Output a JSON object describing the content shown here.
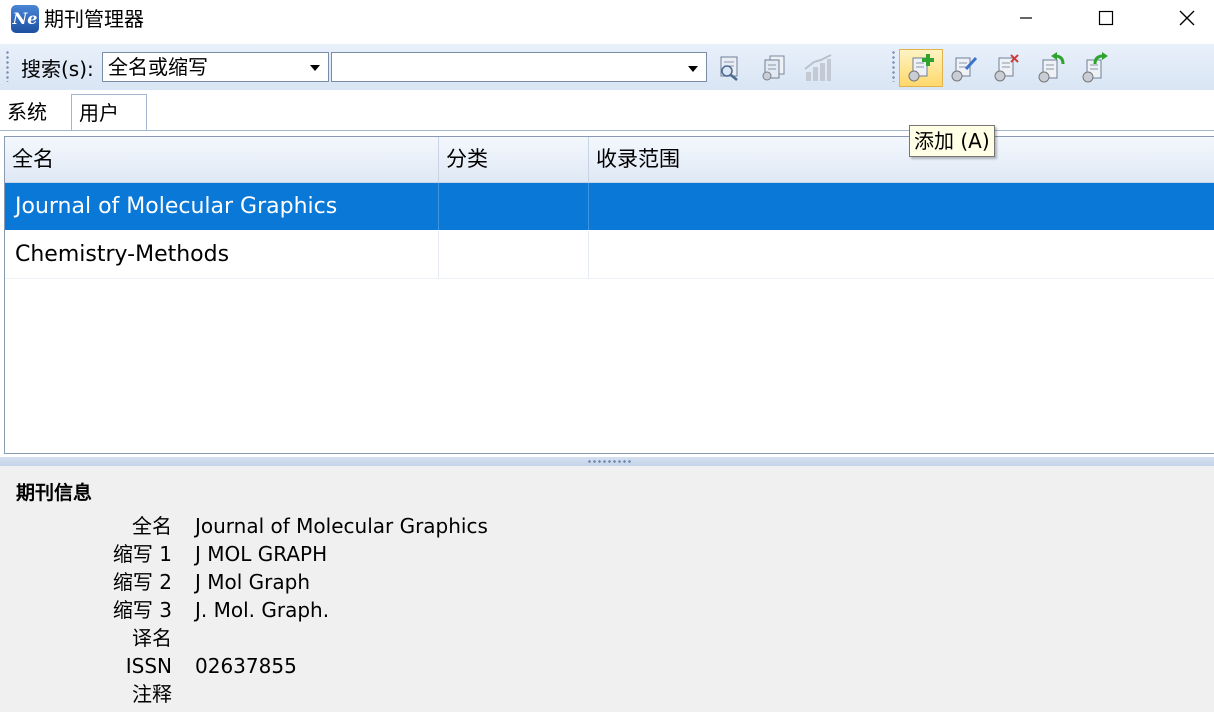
{
  "window": {
    "title": "期刊管理器",
    "icon_text": "Ne",
    "controls": [
      "minimize-icon",
      "maximize-icon",
      "close-icon"
    ]
  },
  "toolbar": {
    "search_label": "搜索(s):",
    "search_field_value": "全名或缩写",
    "search_text_value": "",
    "buttons": [
      {
        "name": "search-journal",
        "icon": "magnifier-document-icon",
        "enabled": true
      },
      {
        "name": "journal-list",
        "icon": "documents-icon",
        "enabled": true
      },
      {
        "name": "statistics",
        "icon": "bar-chart-icon",
        "enabled": false
      },
      {
        "name": "add",
        "icon": "add-document-icon",
        "enabled": true,
        "hover": true
      },
      {
        "name": "edit",
        "icon": "edit-document-icon",
        "enabled": true
      },
      {
        "name": "delete",
        "icon": "delete-document-icon",
        "enabled": true
      },
      {
        "name": "import",
        "icon": "import-document-icon",
        "enabled": true
      },
      {
        "name": "export",
        "icon": "export-document-icon",
        "enabled": true
      }
    ],
    "tooltip": "添加 (A)"
  },
  "tabs": [
    {
      "label": "系统",
      "active": false
    },
    {
      "label": "用户",
      "active": true
    }
  ],
  "grid": {
    "columns": [
      "全名",
      "分类",
      "收录范围"
    ],
    "rows": [
      {
        "full_name": "Journal of Molecular Graphics",
        "category": "",
        "coverage": "",
        "selected": true
      },
      {
        "full_name": "Chemistry-Methods",
        "category": "",
        "coverage": "",
        "selected": false
      }
    ]
  },
  "info": {
    "title": "期刊信息",
    "fields": [
      {
        "label": "全名",
        "value": "Journal of Molecular Graphics"
      },
      {
        "label": "缩写 1",
        "value": "J MOL GRAPH"
      },
      {
        "label": "缩写 2",
        "value": "J Mol Graph"
      },
      {
        "label": "缩写 3",
        "value": "J. Mol. Graph."
      },
      {
        "label": "译名",
        "value": ""
      },
      {
        "label": "ISSN",
        "value": "02637855"
      },
      {
        "label": "注释",
        "value": ""
      }
    ]
  },
  "colors": {
    "selection": "#0a78d7",
    "toolbar_bg": "#dce7f5",
    "info_bg": "#f0f0f0"
  }
}
